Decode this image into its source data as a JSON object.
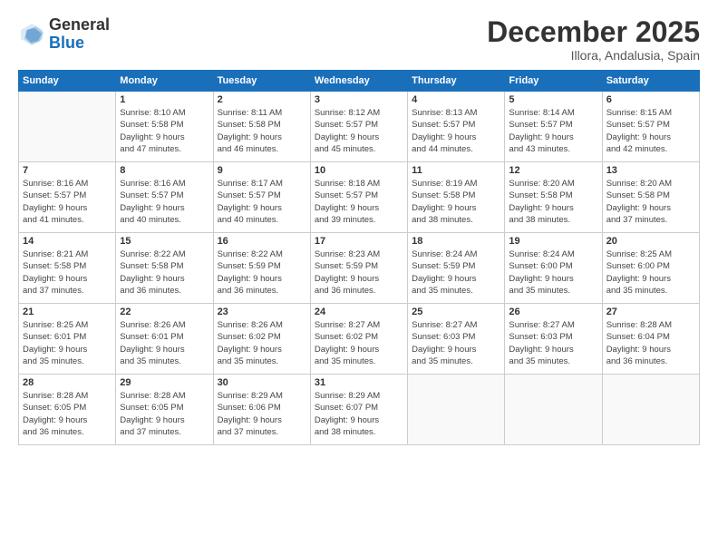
{
  "header": {
    "logo_general": "General",
    "logo_blue": "Blue",
    "month_title": "December 2025",
    "location": "Illora, Andalusia, Spain"
  },
  "days_of_week": [
    "Sunday",
    "Monday",
    "Tuesday",
    "Wednesday",
    "Thursday",
    "Friday",
    "Saturday"
  ],
  "weeks": [
    [
      {
        "date": "",
        "info": ""
      },
      {
        "date": "1",
        "info": "Sunrise: 8:10 AM\nSunset: 5:58 PM\nDaylight: 9 hours\nand 47 minutes."
      },
      {
        "date": "2",
        "info": "Sunrise: 8:11 AM\nSunset: 5:58 PM\nDaylight: 9 hours\nand 46 minutes."
      },
      {
        "date": "3",
        "info": "Sunrise: 8:12 AM\nSunset: 5:57 PM\nDaylight: 9 hours\nand 45 minutes."
      },
      {
        "date": "4",
        "info": "Sunrise: 8:13 AM\nSunset: 5:57 PM\nDaylight: 9 hours\nand 44 minutes."
      },
      {
        "date": "5",
        "info": "Sunrise: 8:14 AM\nSunset: 5:57 PM\nDaylight: 9 hours\nand 43 minutes."
      },
      {
        "date": "6",
        "info": "Sunrise: 8:15 AM\nSunset: 5:57 PM\nDaylight: 9 hours\nand 42 minutes."
      }
    ],
    [
      {
        "date": "7",
        "info": "Sunrise: 8:16 AM\nSunset: 5:57 PM\nDaylight: 9 hours\nand 41 minutes."
      },
      {
        "date": "8",
        "info": "Sunrise: 8:16 AM\nSunset: 5:57 PM\nDaylight: 9 hours\nand 40 minutes."
      },
      {
        "date": "9",
        "info": "Sunrise: 8:17 AM\nSunset: 5:57 PM\nDaylight: 9 hours\nand 40 minutes."
      },
      {
        "date": "10",
        "info": "Sunrise: 8:18 AM\nSunset: 5:57 PM\nDaylight: 9 hours\nand 39 minutes."
      },
      {
        "date": "11",
        "info": "Sunrise: 8:19 AM\nSunset: 5:58 PM\nDaylight: 9 hours\nand 38 minutes."
      },
      {
        "date": "12",
        "info": "Sunrise: 8:20 AM\nSunset: 5:58 PM\nDaylight: 9 hours\nand 38 minutes."
      },
      {
        "date": "13",
        "info": "Sunrise: 8:20 AM\nSunset: 5:58 PM\nDaylight: 9 hours\nand 37 minutes."
      }
    ],
    [
      {
        "date": "14",
        "info": "Sunrise: 8:21 AM\nSunset: 5:58 PM\nDaylight: 9 hours\nand 37 minutes."
      },
      {
        "date": "15",
        "info": "Sunrise: 8:22 AM\nSunset: 5:58 PM\nDaylight: 9 hours\nand 36 minutes."
      },
      {
        "date": "16",
        "info": "Sunrise: 8:22 AM\nSunset: 5:59 PM\nDaylight: 9 hours\nand 36 minutes."
      },
      {
        "date": "17",
        "info": "Sunrise: 8:23 AM\nSunset: 5:59 PM\nDaylight: 9 hours\nand 36 minutes."
      },
      {
        "date": "18",
        "info": "Sunrise: 8:24 AM\nSunset: 5:59 PM\nDaylight: 9 hours\nand 35 minutes."
      },
      {
        "date": "19",
        "info": "Sunrise: 8:24 AM\nSunset: 6:00 PM\nDaylight: 9 hours\nand 35 minutes."
      },
      {
        "date": "20",
        "info": "Sunrise: 8:25 AM\nSunset: 6:00 PM\nDaylight: 9 hours\nand 35 minutes."
      }
    ],
    [
      {
        "date": "21",
        "info": "Sunrise: 8:25 AM\nSunset: 6:01 PM\nDaylight: 9 hours\nand 35 minutes."
      },
      {
        "date": "22",
        "info": "Sunrise: 8:26 AM\nSunset: 6:01 PM\nDaylight: 9 hours\nand 35 minutes."
      },
      {
        "date": "23",
        "info": "Sunrise: 8:26 AM\nSunset: 6:02 PM\nDaylight: 9 hours\nand 35 minutes."
      },
      {
        "date": "24",
        "info": "Sunrise: 8:27 AM\nSunset: 6:02 PM\nDaylight: 9 hours\nand 35 minutes."
      },
      {
        "date": "25",
        "info": "Sunrise: 8:27 AM\nSunset: 6:03 PM\nDaylight: 9 hours\nand 35 minutes."
      },
      {
        "date": "26",
        "info": "Sunrise: 8:27 AM\nSunset: 6:03 PM\nDaylight: 9 hours\nand 35 minutes."
      },
      {
        "date": "27",
        "info": "Sunrise: 8:28 AM\nSunset: 6:04 PM\nDaylight: 9 hours\nand 36 minutes."
      }
    ],
    [
      {
        "date": "28",
        "info": "Sunrise: 8:28 AM\nSunset: 6:05 PM\nDaylight: 9 hours\nand 36 minutes."
      },
      {
        "date": "29",
        "info": "Sunrise: 8:28 AM\nSunset: 6:05 PM\nDaylight: 9 hours\nand 37 minutes."
      },
      {
        "date": "30",
        "info": "Sunrise: 8:29 AM\nSunset: 6:06 PM\nDaylight: 9 hours\nand 37 minutes."
      },
      {
        "date": "31",
        "info": "Sunrise: 8:29 AM\nSunset: 6:07 PM\nDaylight: 9 hours\nand 38 minutes."
      },
      {
        "date": "",
        "info": ""
      },
      {
        "date": "",
        "info": ""
      },
      {
        "date": "",
        "info": ""
      }
    ]
  ]
}
